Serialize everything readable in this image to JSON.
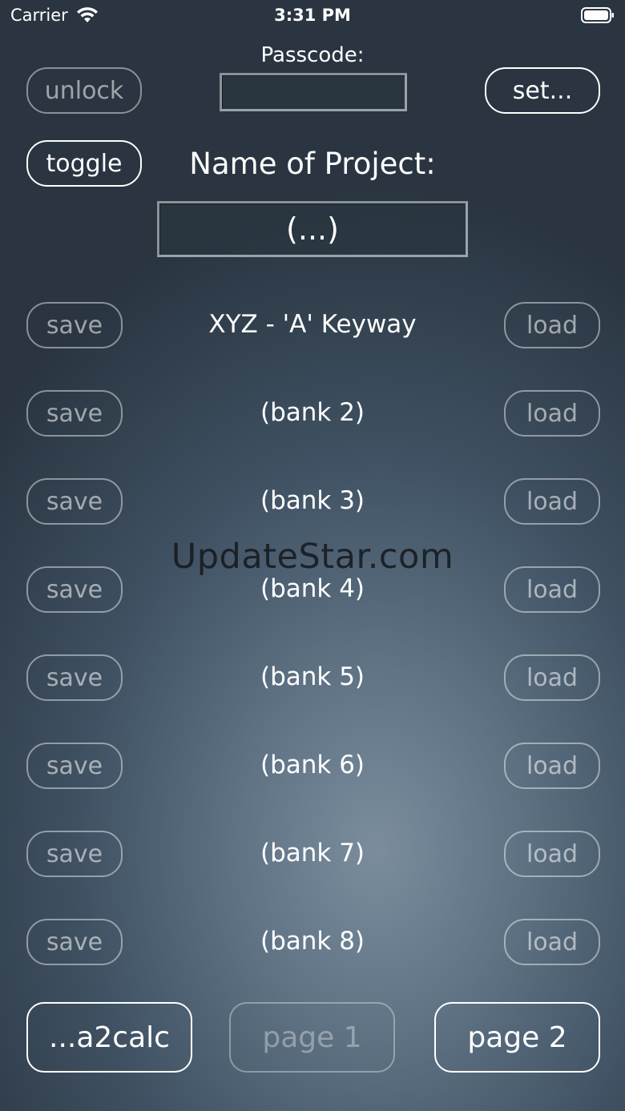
{
  "status_bar": {
    "carrier": "Carrier",
    "time": "3:31 PM"
  },
  "header": {
    "unlock_label": "unlock",
    "passcode_label": "Passcode:",
    "passcode_value": "",
    "set_label": "set...",
    "toggle_label": "toggle",
    "project_name_label": "Name of Project:",
    "project_name_value": "(...)"
  },
  "banks": [
    {
      "save_label": "save",
      "name": "XYZ - 'A' Keyway",
      "load_label": "load"
    },
    {
      "save_label": "save",
      "name": "(bank 2)",
      "load_label": "load"
    },
    {
      "save_label": "save",
      "name": "(bank 3)",
      "load_label": "load"
    },
    {
      "save_label": "save",
      "name": "(bank 4)",
      "load_label": "load"
    },
    {
      "save_label": "save",
      "name": "(bank 5)",
      "load_label": "load"
    },
    {
      "save_label": "save",
      "name": "(bank 6)",
      "load_label": "load"
    },
    {
      "save_label": "save",
      "name": "(bank 7)",
      "load_label": "load"
    },
    {
      "save_label": "save",
      "name": "(bank 8)",
      "load_label": "load"
    }
  ],
  "footer": {
    "a2calc_label": "...a2calc",
    "page1_label": "page 1",
    "page2_label": "page 2"
  },
  "watermark": "UpdateStar.com"
}
